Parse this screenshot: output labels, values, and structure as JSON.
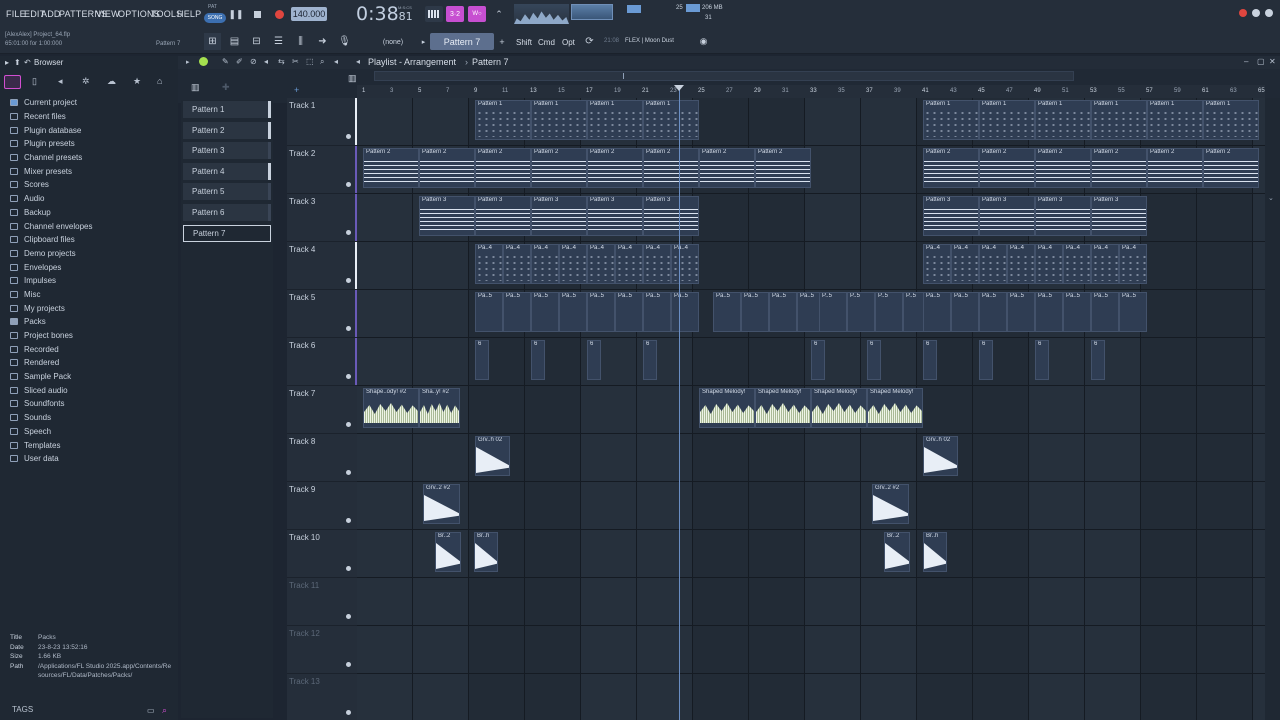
{
  "menu": [
    "FILE",
    "EDIT",
    "ADD",
    "PATTERNS",
    "VIEW",
    "OPTIONS",
    "TOOLS",
    "HELP"
  ],
  "pat_song": {
    "pat": "PAT",
    "song": "SONG"
  },
  "tempo": "140.000",
  "time": {
    "main": "0:38",
    "sub": "81",
    "label": "M:S:CS"
  },
  "memory": {
    "cpu": "25",
    "mem": "206 MB",
    "poly": "31"
  },
  "project": {
    "user": "[AlexAlex] Project_64.flp",
    "time": "65:01:00 for 1:00:000",
    "pattern": "Pattern 7"
  },
  "toolbar2": {
    "preset": "(none)",
    "current_pattern": "Pattern 7",
    "shift": "Shift",
    "cmd": "Cmd",
    "opt": "Opt",
    "hint_time": "21:08",
    "hint_text": "FLEX | Moon Dust"
  },
  "browser": {
    "title": "Browser",
    "items": [
      "Current project",
      "Recent files",
      "Plugin database",
      "Plugin presets",
      "Channel presets",
      "Mixer presets",
      "Scores",
      "Audio",
      "Backup",
      "Channel envelopes",
      "Clipboard files",
      "Demo projects",
      "Envelopes",
      "Impulses",
      "Misc",
      "My projects",
      "Packs",
      "Project bones",
      "Recorded",
      "Rendered",
      "Sample Pack",
      "Sliced audio",
      "Soundfonts",
      "Sounds",
      "Speech",
      "Templates",
      "User data"
    ],
    "info": {
      "title_k": "Title",
      "title_v": "Packs",
      "date_k": "Date",
      "date_v": "23-8-23 13:52:16",
      "size_k": "Size",
      "size_v": "1.66 KB",
      "path_k": "Path",
      "path_v": "/Applications/FL Studio 2025.app/Contents/Resources/FL/Data/Patches/Packs/"
    },
    "tags": "TAGS"
  },
  "playlist": {
    "title": "Playlist - Arrangement",
    "pattern": "Pattern 7",
    "patterns": [
      "Pattern 1",
      "Pattern 2",
      "Pattern 3",
      "Pattern 4",
      "Pattern 5",
      "Pattern 6",
      "Pattern 7"
    ],
    "tracks": [
      "Track 1",
      "Track 2",
      "Track 3",
      "Track 4",
      "Track 5",
      "Track 6",
      "Track 7",
      "Track 8",
      "Track 9",
      "Track 10",
      "Track 11",
      "Track 12",
      "Track 13"
    ],
    "ruler": [
      "1",
      "3",
      "5",
      "7",
      "9",
      "11",
      "13",
      "15",
      "17",
      "19",
      "21",
      "23",
      "25",
      "27",
      "29",
      "31",
      "33",
      "35",
      "37",
      "39",
      "41",
      "43",
      "45",
      "47",
      "49",
      "51",
      "53",
      "55",
      "57",
      "59",
      "61",
      "63",
      "65"
    ]
  },
  "clips": {
    "p1": "Pattern 1",
    "p2": "Pattern 2",
    "p3": "Pattern 3",
    "p4": "Pa..4",
    "p5": "Pa..5",
    "p5b": "P..5",
    "p6": "6",
    "audio_a": "Shape..ody! #2",
    "audio_b": "Sha..y! #2",
    "audio_c": "Shaped Melody!",
    "grv02": "Grv..h 02",
    "grv2": "Grv..2 #2",
    "br2": "Br..2",
    "brh": "Br..h"
  }
}
